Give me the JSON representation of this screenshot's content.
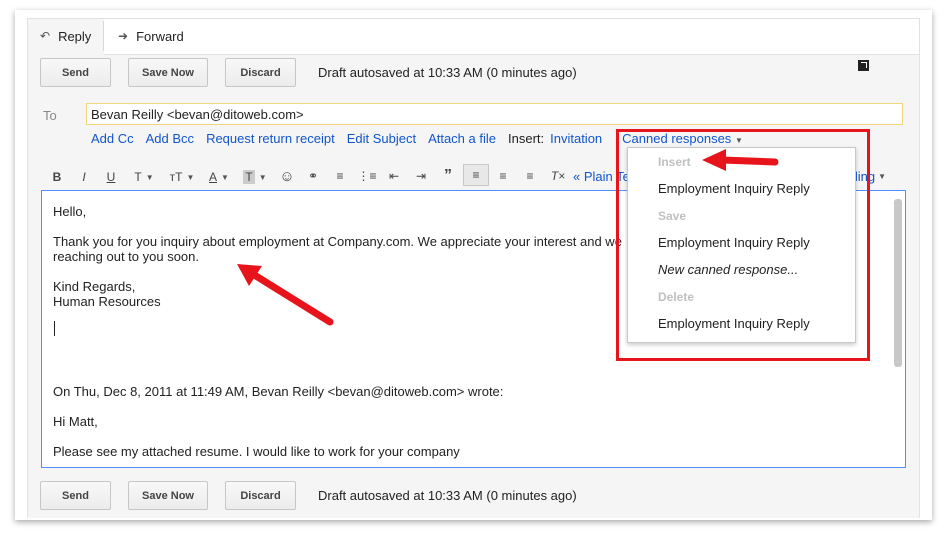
{
  "tabs": {
    "reply": "Reply",
    "forward": "Forward"
  },
  "top_bar": {
    "send": "Send",
    "save_now": "Save Now",
    "discard": "Discard",
    "status": "Draft autosaved at 10:33 AM (0 minutes ago)"
  },
  "bottom_bar": {
    "send": "Send",
    "save_now": "Save Now",
    "discard": "Discard",
    "status": "Draft autosaved at 10:33 AM (0 minutes ago)"
  },
  "compose": {
    "to_label": "To",
    "to_value": "Bevan Reilly <bevan@ditoweb.com>",
    "links": {
      "add_cc": "Add Cc",
      "add_bcc": "Add Bcc",
      "request_receipt": "Request return receipt",
      "edit_subject": "Edit Subject",
      "attach_file": "Attach a file",
      "insert_label": "Insert:",
      "invitation": "Invitation",
      "canned": "Canned responses"
    }
  },
  "toolbar": {
    "bold": "B",
    "italic": "I",
    "underline": "U",
    "font": "T",
    "size": "тT",
    "text_color": "A",
    "highlight": "T",
    "plain_text": "« Plain Te",
    "spelling": "lling"
  },
  "body": {
    "greeting": "Hello,",
    "line1": "Thank you for you inquiry about employment at Company.com.  We appreciate your interest and we",
    "line2": "reaching out to you soon.",
    "regards": "Kind Regards,",
    "signature": "Human Resources",
    "quote_header": "On Thu, Dec 8, 2011 at 11:49 AM, Bevan Reilly <bevan@ditoweb.com> wrote:",
    "quote_greeting": "Hi Matt,",
    "quote_line": "Please see my attached resume.  I would like to work for your company"
  },
  "canned_menu": {
    "insert_header": "Insert",
    "insert_item": "Employment Inquiry Reply",
    "save_header": "Save",
    "save_item": "Employment Inquiry Reply",
    "new_item": "New canned response...",
    "delete_header": "Delete",
    "delete_item": "Employment Inquiry Reply"
  },
  "colors": {
    "link": "#1155cc",
    "annotation": "#e8141c",
    "focus_border": "#4d90fe"
  }
}
